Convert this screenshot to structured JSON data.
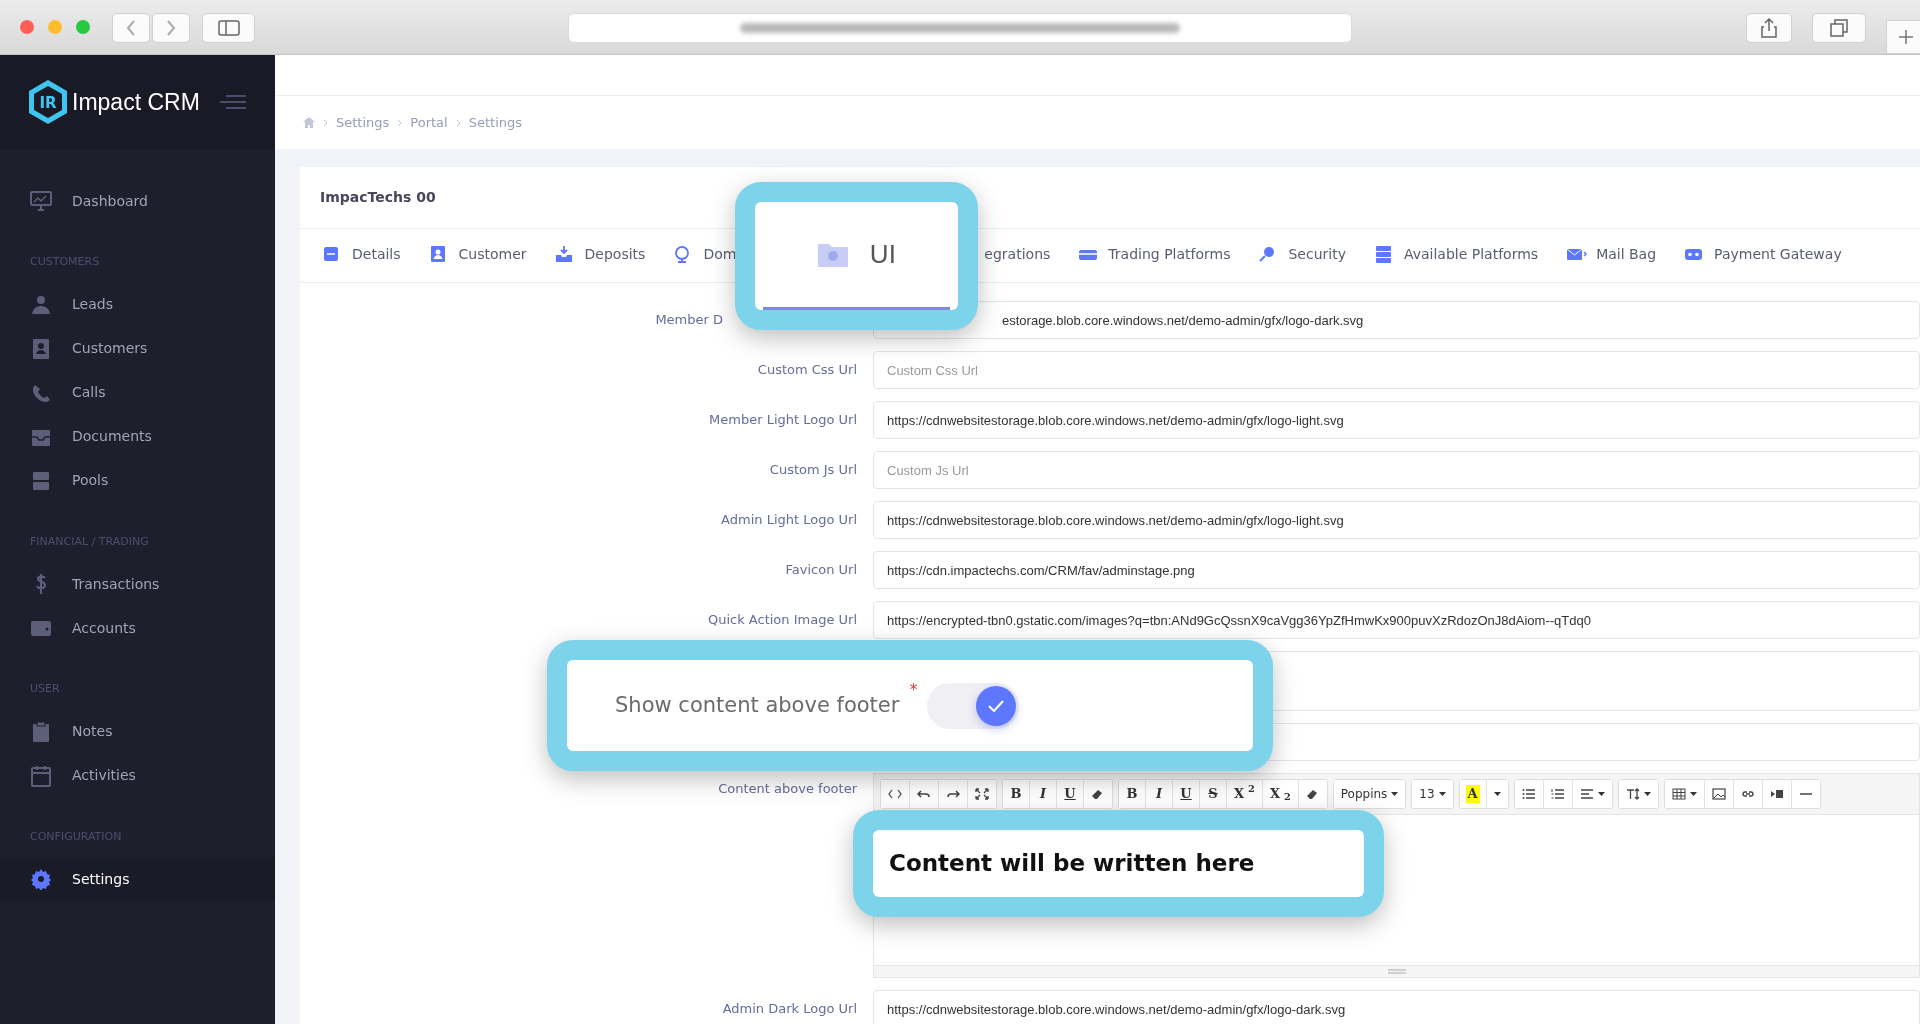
{
  "app": {
    "name": "Impact CRM",
    "logo_text": "IR"
  },
  "sidebar": {
    "sections": [
      {
        "items": [
          {
            "label": "Dashboard",
            "selected": false
          }
        ]
      },
      {
        "heading": "CUSTOMERS",
        "items": [
          {
            "label": "Leads",
            "selected": false
          },
          {
            "label": "Customers",
            "selected": false
          },
          {
            "label": "Calls",
            "selected": false
          },
          {
            "label": "Documents",
            "selected": false
          },
          {
            "label": "Pools",
            "selected": false
          }
        ]
      },
      {
        "heading": "FINANCIAL / TRADING",
        "items": [
          {
            "label": "Transactions",
            "selected": false
          },
          {
            "label": "Accounts",
            "selected": false
          }
        ]
      },
      {
        "heading": "USER",
        "items": [
          {
            "label": "Notes",
            "selected": false
          },
          {
            "label": "Activities",
            "selected": false
          }
        ]
      },
      {
        "heading": "CONFIGURATION",
        "items": [
          {
            "label": "Settings",
            "selected": true
          }
        ]
      }
    ]
  },
  "breadcrumb": [
    "Settings",
    "Portal",
    "Settings"
  ],
  "card": {
    "title": "ImpacTechs 00"
  },
  "tabs": [
    {
      "label": "Details",
      "selected": false
    },
    {
      "label": "Customer",
      "selected": false
    },
    {
      "label": "Deposits",
      "selected": false
    },
    {
      "label": "Dom",
      "selected": false
    },
    {
      "label": "egrations",
      "selected": false
    },
    {
      "label": "Trading Platforms",
      "selected": false
    },
    {
      "label": "Security",
      "selected": false
    },
    {
      "label": "Available Platforms",
      "selected": false
    },
    {
      "label": "Mail Bag",
      "selected": false
    },
    {
      "label": "Payment Gateway",
      "selected": false
    }
  ],
  "tab_callout": {
    "label": "UI",
    "selected": true
  },
  "fields": [
    {
      "kind": "obscured",
      "label": "Member D",
      "value": "estorage.blob.core.windows.net/demo-admin/gfx/logo-dark.svg"
    },
    {
      "kind": "text",
      "label": "Custom Css Url",
      "placeholder": "Custom Css Url"
    },
    {
      "kind": "text",
      "label": "Member Light Logo Url",
      "value": "https://cdnwebsitestorage.blob.core.windows.net/demo-admin/gfx/logo-light.svg"
    },
    {
      "kind": "text",
      "label": "Custom Js Url",
      "placeholder": "Custom Js Url"
    },
    {
      "kind": "text",
      "label": "Admin Light Logo Url",
      "value": "https://cdnwebsitestorage.blob.core.windows.net/demo-admin/gfx/logo-light.svg"
    },
    {
      "kind": "text",
      "label": "Favicon Url",
      "value": "https://cdn.impactechs.com/CRM/fav/adminstage.png"
    },
    {
      "kind": "text",
      "label": "Quick Action Image Url",
      "value": "https://encrypted-tbn0.gstatic.com/images?q=tbn:ANd9GcQssnX9caVgg36YpZfHmwKx900puvXzRdozOnJ8dAiom--qTdq0"
    }
  ],
  "toggle_callout": {
    "label": "Show content above footer",
    "required_mark": "*",
    "checked": true
  },
  "editor": {
    "label": "Content above footer",
    "toolbar": [
      [
        {
          "kind": "icon"
        },
        {
          "kind": "icon"
        },
        {
          "kind": "icon"
        },
        {
          "kind": "icon"
        }
      ],
      [
        {
          "kind": "letter",
          "label": "B"
        },
        {
          "kind": "letter",
          "label": "I"
        },
        {
          "kind": "letter",
          "label": "U"
        },
        {
          "kind": "icon"
        }
      ],
      [
        {
          "kind": "letter",
          "label": "B"
        },
        {
          "kind": "letter",
          "label": "I"
        },
        {
          "kind": "letter",
          "label": "U"
        },
        {
          "kind": "letter",
          "label": "S"
        },
        {
          "kind": "letter",
          "label": "X$^{2}$"
        },
        {
          "kind": "letter",
          "label": "X$_{2}$"
        },
        {
          "kind": "icon"
        }
      ],
      [
        {
          "kind": "dropdown",
          "label": "Poppins"
        }
      ],
      [
        {
          "kind": "dropdown",
          "label": "13"
        }
      ],
      [
        {
          "kind": "swatch",
          "label": "A"
        },
        {
          "kind": "caret"
        }
      ],
      [
        {
          "kind": "icon"
        },
        {
          "kind": "icon"
        },
        {
          "kind": "icon-dropdown"
        }
      ],
      [
        {
          "kind": "icon-dropdown"
        }
      ],
      [
        {
          "kind": "icon-dropdown"
        },
        {
          "kind": "icon"
        },
        {
          "kind": "icon"
        },
        {
          "kind": "icon"
        },
        {
          "kind": "icon"
        }
      ]
    ]
  },
  "content_callout": {
    "text": "Content will be written here"
  },
  "last_field": {
    "label": "Admin Dark Logo Url",
    "value": "https://cdnwebsitestorage.blob.core.windows.net/demo-admin/gfx/logo-dark.svg"
  }
}
